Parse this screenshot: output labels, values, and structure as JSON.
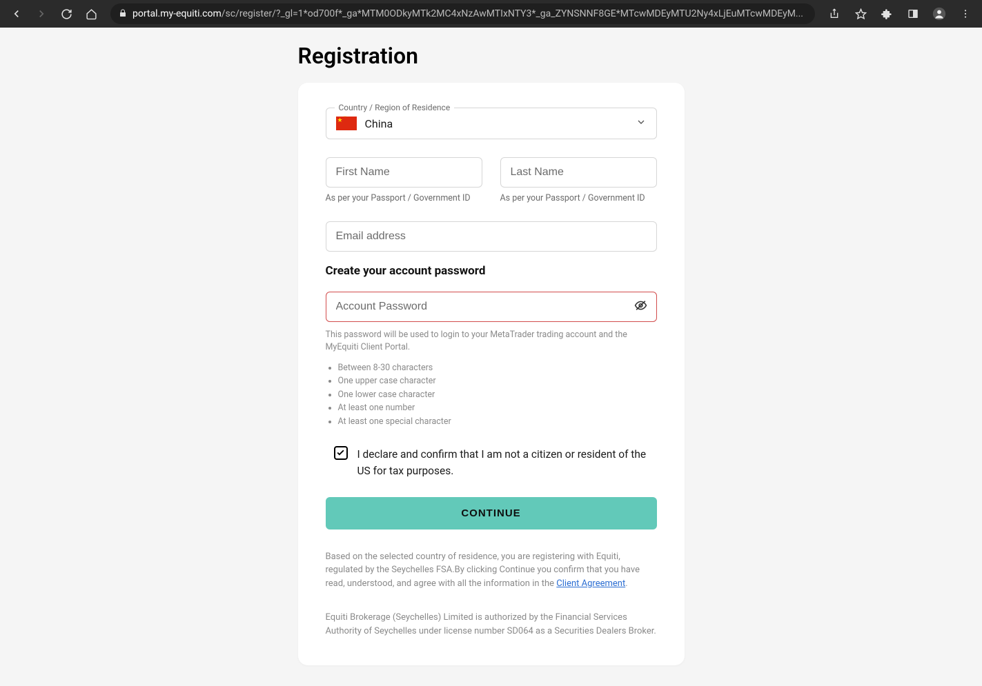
{
  "browser": {
    "url_domain": "portal.my-equiti.com",
    "url_path": "/sc/register/?_gl=1*od700f*_ga*MTM0ODkyMTk2MC4xNzAwMTIxNTY3*_ga_ZYNSNNF8GE*MTcwMDEyMTU2Ny4xLjEuMTcwMDEyM...",
    "url_suffix": ""
  },
  "page": {
    "title": "Registration"
  },
  "form": {
    "country_label": "Country / Region of Residence",
    "country_value": "China",
    "first_name_placeholder": "First Name",
    "last_name_placeholder": "Last Name",
    "name_hint": "As per your Passport / Government ID",
    "email_placeholder": "Email address",
    "password_section_title": "Create your account password",
    "password_placeholder": "Account Password",
    "password_hint": "This password will be used to login to your MetaTrader trading account and the MyEquiti Client Portal.",
    "requirements": [
      "Between 8-30 characters",
      "One upper case character",
      "One lower case character",
      "At least one number",
      "At least one special character"
    ],
    "declaration": "I declare and confirm that I am not a citizen or resident of the US for tax purposes.",
    "continue_label": "CONTINUE"
  },
  "legal": {
    "agreement_text_pre": "Based on the selected country of residence, you are registering with Equiti, regulated by the Seychelles FSA.By clicking Continue you confirm that you have read, understood, and agree with all the information in the ",
    "agreement_link": "Client Agreement",
    "agreement_text_post": ".",
    "authorization": "Equiti Brokerage (Seychelles) Limited is authorized by the Financial Services Authority of Seychelles under license number SD064 as a Securities Dealers Broker."
  }
}
